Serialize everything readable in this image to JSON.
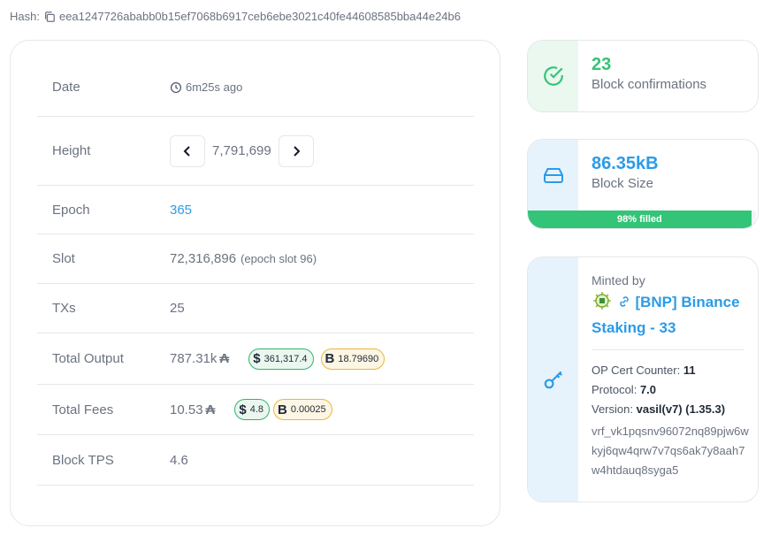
{
  "hash": {
    "label": "Hash:",
    "value": "eea1247726ababb0b15ef7068b6917ceb6ebe3021c40fe44608585bba44e24b6",
    "icon": "copy-icon"
  },
  "details": {
    "date": {
      "label": "Date",
      "value": "6m25s ago"
    },
    "height": {
      "label": "Height",
      "value": "7,791,699"
    },
    "epoch": {
      "label": "Epoch",
      "value": "365"
    },
    "slot": {
      "label": "Slot",
      "value": "72,316,896",
      "note": "(epoch slot 96)"
    },
    "txs": {
      "label": "TXs",
      "value": "25"
    },
    "total_output": {
      "label": "Total Output",
      "value": "787.31k",
      "ada": "₳",
      "usd": "361,317.4",
      "btc": "18.79690"
    },
    "total_fees": {
      "label": "Total Fees",
      "value": "10.53",
      "ada": "₳",
      "usd": "4.8",
      "btc": "0.00025"
    },
    "block_tps": {
      "label": "Block TPS",
      "value": "4.6"
    }
  },
  "currency": {
    "usd_symbol": "$",
    "btc_symbol": "B"
  },
  "confirmations": {
    "value": "23",
    "label": "Block confirmations",
    "color": "#33c477"
  },
  "block_size": {
    "value": "86.35kB",
    "label": "Block Size",
    "fill_text": "98% filled",
    "fill_percent": 98,
    "color": "#2b9be8"
  },
  "minted": {
    "label": "Minted by",
    "pool_name": "[BNP] Binance Staking - 33",
    "op_cert_label": "OP Cert Counter:",
    "op_cert_value": "11",
    "protocol_label": "Protocol:",
    "protocol_value": "7.0",
    "version_label": "Version:",
    "version_value": "vasil(v7) (1.35.3)",
    "vrf": "vrf_vk1pqsnv96072nq89pjw6wkyj6qw4qrw7v7qs6ak7y8aah7w4htdauq8syga5"
  }
}
